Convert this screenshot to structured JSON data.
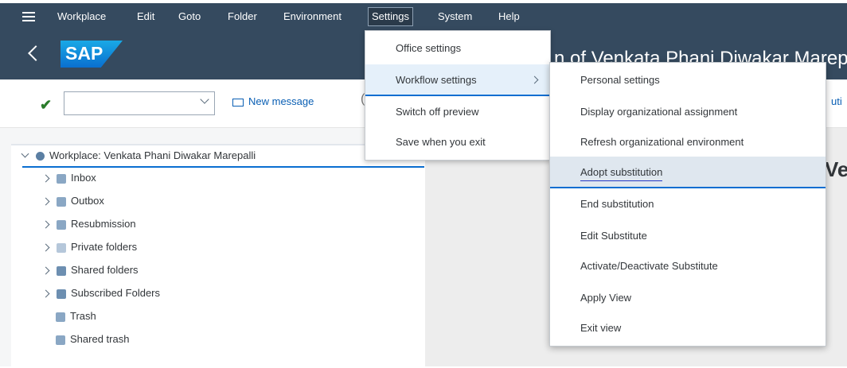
{
  "menubar": {
    "items": [
      "Workplace",
      "Edit",
      "Goto",
      "Folder",
      "Environment",
      "Settings",
      "System",
      "Help"
    ]
  },
  "titlebar": {
    "logo_text": "SAP",
    "title": "n of Venkata Phani Diwakar Marepa"
  },
  "toolbar": {
    "command_value": "",
    "new_message_label": "New message",
    "stub_left": "(",
    "stub_right": "uti"
  },
  "tree": {
    "root": "Workplace: Venkata Phani Diwakar Marepalli",
    "items": [
      {
        "label": "Inbox",
        "icon": "inbox-icon",
        "expandable": true
      },
      {
        "label": "Outbox",
        "icon": "outbox-icon",
        "expandable": true
      },
      {
        "label": "Resubmission",
        "icon": "resubmission-icon",
        "expandable": true
      },
      {
        "label": "Private folders",
        "icon": "private-folders-icon",
        "expandable": true
      },
      {
        "label": "Shared folders",
        "icon": "shared-folders-icon",
        "expandable": true
      },
      {
        "label": "Subscribed Folders",
        "icon": "subscribed-folders-icon",
        "expandable": true
      },
      {
        "label": "Trash",
        "icon": "trash-icon",
        "expandable": false
      },
      {
        "label": "Shared trash",
        "icon": "trash-icon",
        "expandable": false
      }
    ]
  },
  "right_heading": "Ve",
  "settings_menu": {
    "items": [
      "Office settings",
      "Workflow settings",
      "Switch off preview",
      "Save when you exit"
    ]
  },
  "workflow_submenu": {
    "items": [
      "Personal settings",
      "Display organizational assignment",
      "Refresh organizational environment",
      "Adopt substitution",
      "End substitution",
      "Edit Substitute",
      "Activate/Deactivate Substitute",
      "Apply View",
      "Exit view"
    ]
  },
  "colors": {
    "shell": "#354a5f",
    "accent": "#0a6ed1",
    "hover": "#dfe7ef"
  }
}
